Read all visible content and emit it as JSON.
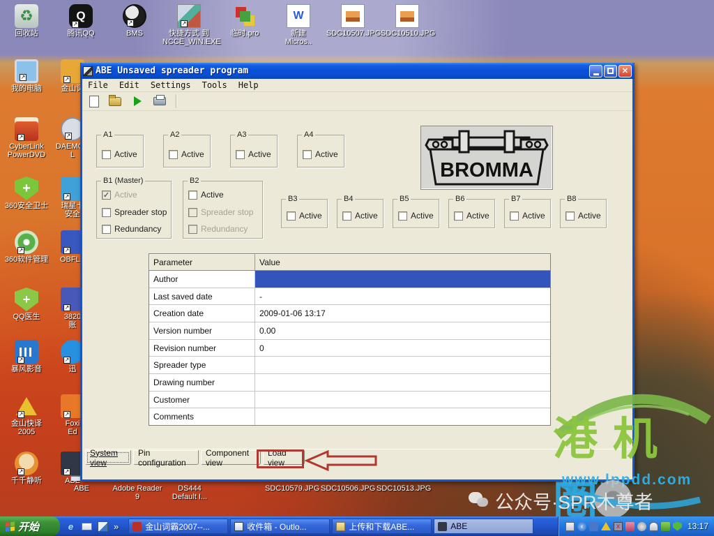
{
  "colors": {
    "xp_blue": "#0c59d8",
    "selection_blue": "#3355bb",
    "annotation_red": "#b03830",
    "taskbar_blue": "#2257cf",
    "start_green": "#3c9338",
    "watermark_green": "#8cc63e",
    "watermark_blue": "#2ea8e0"
  },
  "desktop": {
    "top_icons": [
      {
        "label": "回收站",
        "icon": "recycle-bin-icon"
      },
      {
        "label": "腾讯QQ",
        "icon": "qq-icon"
      },
      {
        "label": "BMS",
        "icon": "gauge-icon"
      },
      {
        "label": "快捷方式 到\nNCCE_WIN.EXE",
        "icon": "app-collage-icon"
      },
      {
        "label": "临时.pro",
        "icon": "pro-file-icon"
      },
      {
        "label": "新建\nMicros..",
        "icon": "word-doc-icon"
      },
      {
        "label": "SDC10507.JPG",
        "icon": "jpg-file-icon"
      },
      {
        "label": "SDC10510.JPG",
        "icon": "jpg-file-icon"
      }
    ],
    "left_column": [
      {
        "label": "我的电脑",
        "icon": "my-computer-icon"
      },
      {
        "label": "CyberLink\nPowerDVD",
        "icon": "powerdvd-icon"
      },
      {
        "label": "360安全卫士",
        "icon": "shield-icon"
      },
      {
        "label": "360软件管理",
        "icon": "software-manager-icon"
      },
      {
        "label": "QQ医生",
        "icon": "qq-doctor-icon"
      },
      {
        "label": "暴风影音",
        "icon": "media-player-icon"
      },
      {
        "label": "金山快译\n2005",
        "icon": "translator-icon"
      },
      {
        "label": "千千静听",
        "icon": "music-player-icon"
      }
    ],
    "second_column": [
      {
        "label": "金山词",
        "icon": "dictionary-icon"
      },
      {
        "label": "DAEMON\nL",
        "icon": "daemon-tools-icon"
      },
      {
        "label": "瑞星卡\n安全",
        "icon": "antivirus-icon"
      },
      {
        "label": "OBFLA",
        "icon": "obfla-icon"
      },
      {
        "label": "3820\n账",
        "icon": "document-icon"
      },
      {
        "label": "迅",
        "icon": "thunder-icon"
      },
      {
        "label": "Foxi\nEd",
        "icon": "foxit-icon"
      },
      {
        "label": "ABE",
        "icon": "abe-icon"
      }
    ],
    "bottom_icons": [
      {
        "label": "ABE"
      },
      {
        "label": "Adobe Reader\n9"
      },
      {
        "label": "DS444\nDefault I..."
      },
      {
        "label": "SDC10579.JPG"
      },
      {
        "label": "SDC10506.JPG"
      },
      {
        "label": "SDC10513.JPG"
      }
    ]
  },
  "window": {
    "title": "ABE Unsaved spreader program",
    "menu": [
      {
        "label": "File"
      },
      {
        "label": "Edit"
      },
      {
        "label": "Settings"
      },
      {
        "label": "Tools"
      },
      {
        "label": "Help"
      }
    ],
    "toolbar_icons": [
      "new-file-icon",
      "open-file-icon",
      "run-icon",
      "print-icon"
    ],
    "a_groups": [
      {
        "label": "A1",
        "checkbox": "Active"
      },
      {
        "label": "A2",
        "checkbox": "Active"
      },
      {
        "label": "A3",
        "checkbox": "Active"
      },
      {
        "label": "A4",
        "checkbox": "Active"
      }
    ],
    "b1_group": {
      "label": "B1 (Master)",
      "items": [
        {
          "label": "Active",
          "checked": true,
          "disabled": true
        },
        {
          "label": "Spreader stop",
          "checked": false,
          "disabled": false
        },
        {
          "label": "Redundancy",
          "checked": false,
          "disabled": false
        }
      ]
    },
    "b2_group": {
      "label": "B2",
      "items": [
        {
          "label": "Active",
          "checked": false,
          "disabled": false
        },
        {
          "label": "Spreader stop",
          "checked": false,
          "disabled": true
        },
        {
          "label": "Redundancy",
          "checked": false,
          "disabled": true
        }
      ]
    },
    "b_groups": [
      {
        "label": "B3",
        "checkbox": "Active"
      },
      {
        "label": "B4",
        "checkbox": "Active"
      },
      {
        "label": "B5",
        "checkbox": "Active"
      },
      {
        "label": "B6",
        "checkbox": "Active"
      },
      {
        "label": "B7",
        "checkbox": "Active"
      },
      {
        "label": "B8",
        "checkbox": "Active"
      }
    ],
    "logo_text": "BROMMA",
    "table": {
      "headers": [
        "Parameter",
        "Value"
      ],
      "rows": [
        {
          "parameter": "Author",
          "value": "",
          "selected": true
        },
        {
          "parameter": "Last saved date",
          "value": "-"
        },
        {
          "parameter": "Creation date",
          "value": "2009-01-06 13:17"
        },
        {
          "parameter": "Version number",
          "value": "0.00"
        },
        {
          "parameter": "Revision number",
          "value": "0"
        },
        {
          "parameter": "Spreader type",
          "value": ""
        },
        {
          "parameter": "Drawing number",
          "value": ""
        },
        {
          "parameter": "Customer",
          "value": ""
        },
        {
          "parameter": "Comments",
          "value": ""
        }
      ]
    },
    "tabs": [
      {
        "label": "System view",
        "active": true
      },
      {
        "label": "Pin configuration",
        "active": false
      },
      {
        "label": "Component view",
        "active": false
      },
      {
        "label": "Load view",
        "active": false,
        "highlighted": true
      }
    ]
  },
  "taskbar": {
    "start_label": "开始",
    "overflow_chevron": "»",
    "quick_launch_icons": [
      "ie-icon",
      "mail-icon",
      "show-desktop-icon"
    ],
    "tasks": [
      {
        "label": "金山词霸2007--...",
        "active": false
      },
      {
        "label": "收件箱 - Outlo...",
        "active": false
      },
      {
        "label": "上传和下载ABE...",
        "active": false
      },
      {
        "label": "ABE",
        "active": true
      }
    ],
    "tray_icons": [
      "keyboard-icon",
      "collapse-chevron-icon",
      "network-icon",
      "alert-icon",
      "display-error-icon",
      "scanner-icon",
      "speaker-icon",
      "mouse-icon",
      "suitcase-icon",
      "security-shield-icon"
    ],
    "clock": "13:17"
  },
  "watermark": {
    "title_chars": [
      {
        "char": "港"
      },
      {
        "char": "机"
      },
      {
        "char": "圈"
      }
    ],
    "url": "www.lppdd.com",
    "subtitle": "公众号·SPR木尊者"
  }
}
